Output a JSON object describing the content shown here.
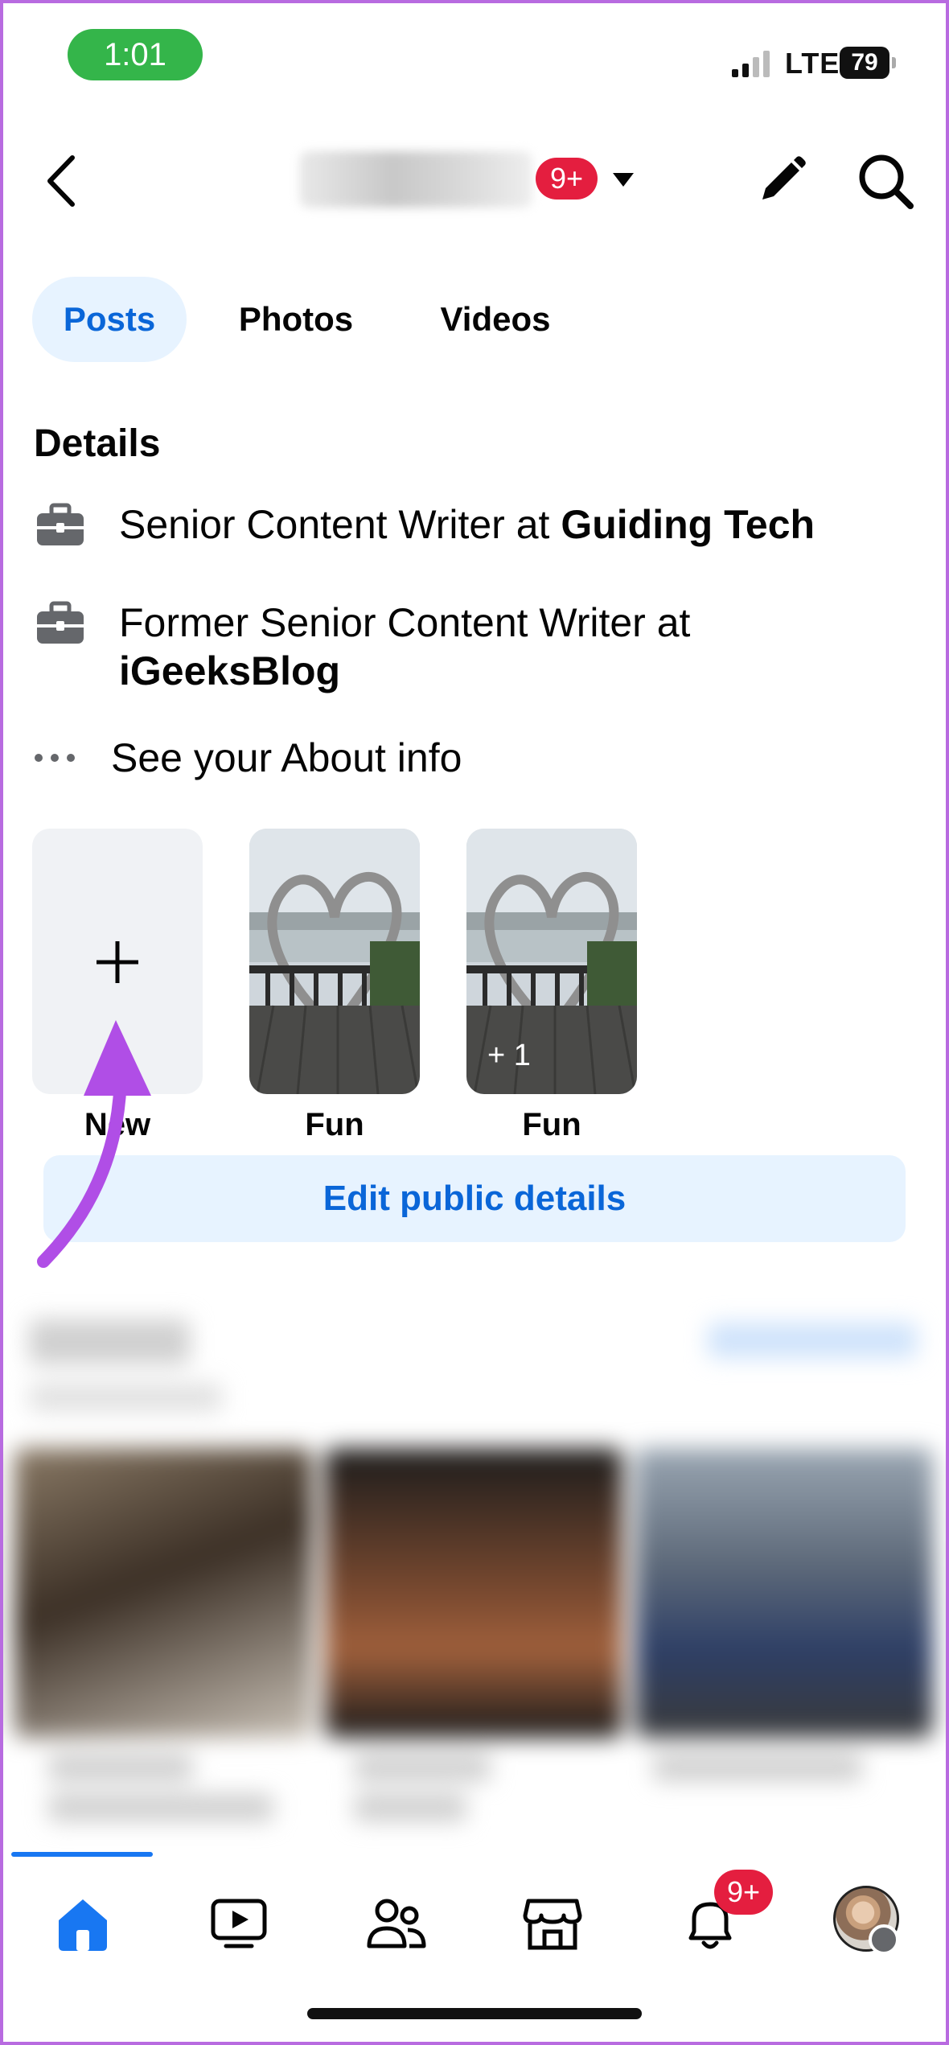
{
  "status_bar": {
    "time": "1:01",
    "network": "LTE",
    "battery": "79"
  },
  "header": {
    "notification_badge": "9+"
  },
  "tabs": [
    {
      "label": "Posts",
      "active": true
    },
    {
      "label": "Photos",
      "active": false
    },
    {
      "label": "Videos",
      "active": false
    }
  ],
  "details": {
    "title": "Details",
    "items": [
      {
        "prefix": "Senior Content Writer at ",
        "bold": "Guiding Tech",
        "icon": "briefcase-icon"
      },
      {
        "prefix": "Former Senior Content Writer at ",
        "bold": "iGeeksBlog",
        "icon": "briefcase-icon"
      }
    ],
    "about_link": "See your About info"
  },
  "highlights": [
    {
      "label": "New",
      "kind": "add"
    },
    {
      "label": "Fun",
      "kind": "photo"
    },
    {
      "label": "Fun",
      "kind": "photo",
      "extra": "+ 1"
    }
  ],
  "edit_public_details": "Edit public details",
  "bottom_nav": {
    "items": [
      "home-icon",
      "video-icon",
      "friends-icon",
      "marketplace-icon",
      "notifications-icon",
      "profile-avatar"
    ],
    "notifications_badge": "9+"
  },
  "colors": {
    "accent": "#0a66d8",
    "tab_active_bg": "#e7f3ff",
    "badge": "#e41e3f",
    "annotation_arrow": "#b04ee6"
  }
}
